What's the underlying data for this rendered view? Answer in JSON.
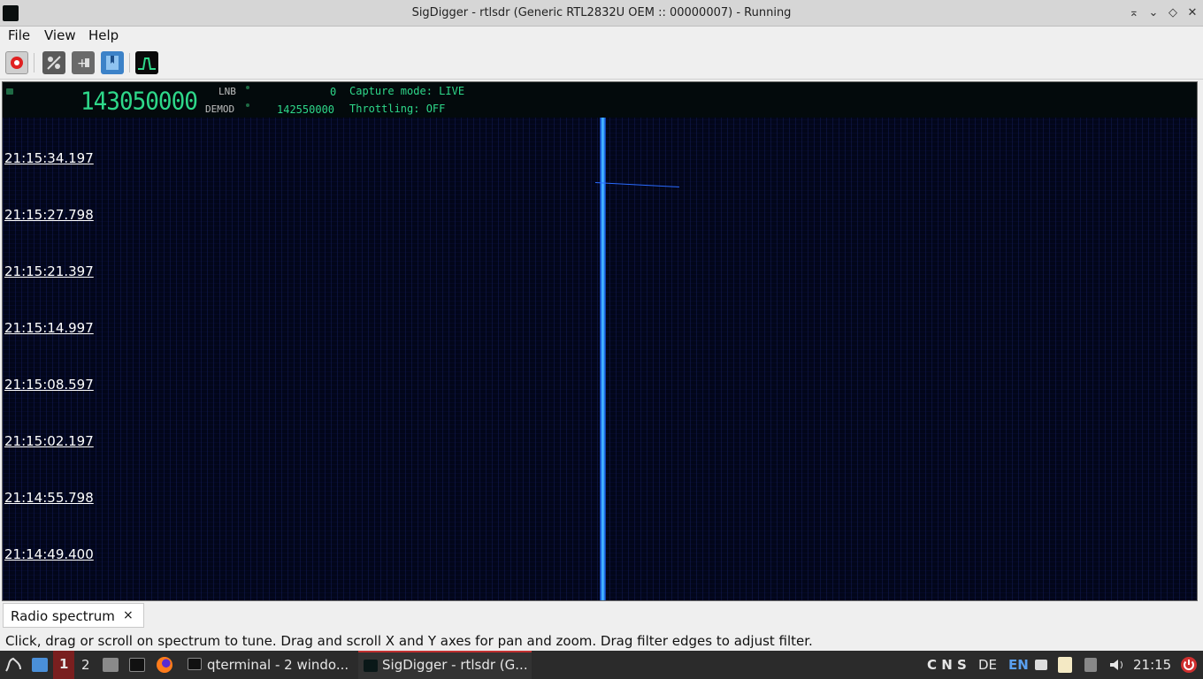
{
  "window": {
    "title": "SigDigger - rtlsdr (Generic RTL2832U OEM :: 00000007) - Running",
    "controls": [
      "⌅",
      "⌄",
      "◇",
      "✕"
    ]
  },
  "menu": {
    "file": "File",
    "view": "View",
    "help": "Help"
  },
  "toolbar": {
    "record_icon": "record-icon",
    "icons": [
      "record-icon",
      "settings-icon",
      "add-icon",
      "bookmark-icon",
      "spectrum-icon"
    ]
  },
  "readout": {
    "main_freq": "143050000",
    "lnb_label": "LNB",
    "lnb_value": "0",
    "demod_label": "DEMOD",
    "demod_value": "142550000",
    "capture_mode": "Capture mode: LIVE",
    "throttling": "Throttling: OFF"
  },
  "waterfall": {
    "timestamps": [
      "21:15:34.197",
      "21:15:27.798",
      "21:15:21.397",
      "21:15:14.997",
      "21:15:08.597",
      "21:15:02.197",
      "21:14:55.798",
      "21:14:49.400"
    ]
  },
  "tabs": {
    "radio_spectrum": "Radio spectrum",
    "close": "×"
  },
  "status": {
    "hint": "Click, drag or scroll on spectrum to tune. Drag and scroll X and Y axes for pan and zoom. Drag filter edges to adjust filter."
  },
  "taskbar": {
    "ws1": "1",
    "ws2": "2",
    "qterminal": "qterminal - 2 windo...",
    "sigdigger": "SigDigger - rtlsdr (G...",
    "keys": "C N S",
    "lang_de": "DE",
    "lang_en": "EN",
    "clock": "21:15"
  },
  "colors": {
    "accent": "#2ed88a",
    "signal": "#2a8cff",
    "active_task": "#c23030"
  }
}
